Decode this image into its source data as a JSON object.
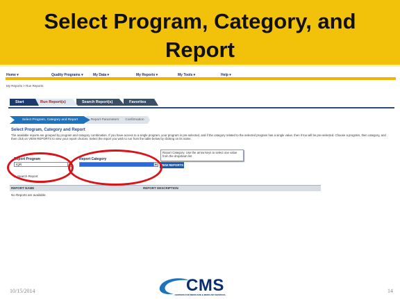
{
  "slide": {
    "title": "Select Program, Category, and Report",
    "date": "10/15/2014",
    "page_number": "14",
    "logo_text": "CMS",
    "logo_subtext": "CENTERS FOR MEDICARE & MEDICAID SERVICES"
  },
  "menu": {
    "items": [
      "Home ▾",
      "Quality Programs ▾",
      "My Data ▾",
      "My Reports ▾",
      "My Tools ▾",
      "Help ▾"
    ]
  },
  "breadcrumb": "My Reports > Run Reports",
  "tabs": [
    "Start",
    "Run Report(s)",
    "Search Report(s)",
    "Favorites"
  ],
  "steps": [
    "Select Program, Category and Report",
    "Report Parameters",
    "Confirmation"
  ],
  "section": {
    "title": "Select Program, Category and Report",
    "description": "The available reports are grouped by program and category combination. If you have access to a single program, your program is pre-selected, and if the category related to the selected program has a single value, then it too will be pre-selected. Choose a program, then category, and then click on VIEW REPORTS to view your report choices. Select the report you wish to run from the table below by clicking on its name."
  },
  "form": {
    "program_label": "Report Program",
    "program_value": "IQR",
    "category_label": "Report Category",
    "category_value": "",
    "view_button": "VIEW REPORTS",
    "tooltip": "Report Category. Use the arrow keys to select one value from the dropdown list",
    "search_link": "Search Report"
  },
  "table": {
    "columns": [
      "REPORT NAME",
      "REPORT DESCRIPTION"
    ],
    "empty_message": "No Reports are available."
  },
  "colors": {
    "title_band": "#f2c20a",
    "highlight_ring": "#d8141a",
    "accent_blue": "#1e73be"
  }
}
